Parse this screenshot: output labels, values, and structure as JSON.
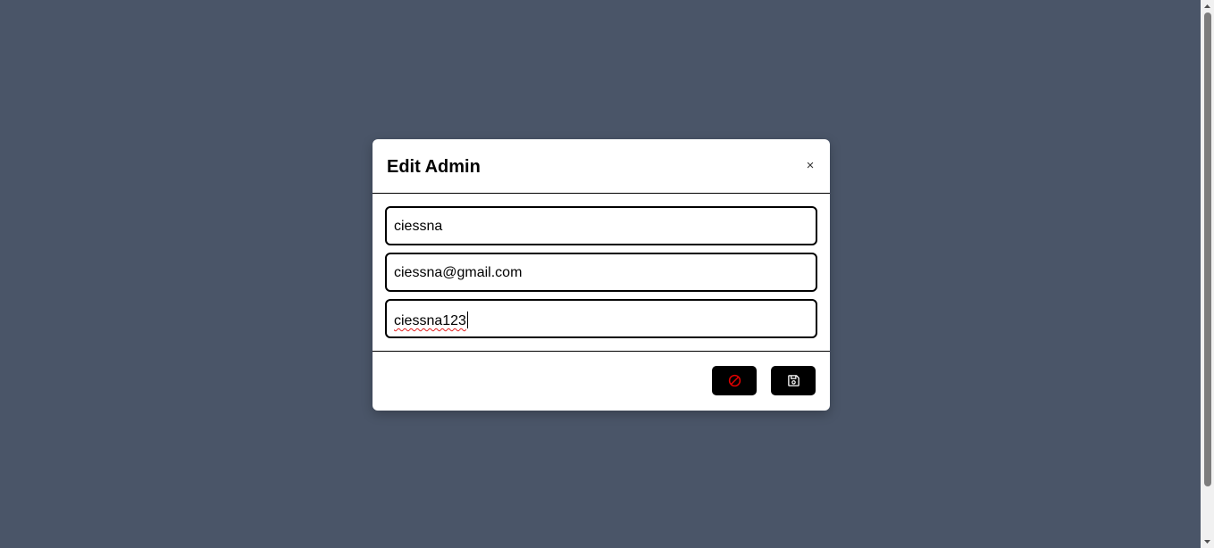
{
  "colors": {
    "backdrop": "#4a5568",
    "accent_danger": "#e00000",
    "button_bg": "#000000"
  },
  "modal": {
    "title": "Edit Admin",
    "close_label": "×",
    "fields": {
      "username": "ciessna",
      "email": "ciessna@gmail.com",
      "password": "ciessna123"
    },
    "buttons": {
      "cancel_icon": "ban-icon",
      "save_icon": "floppy-disk-icon"
    }
  }
}
